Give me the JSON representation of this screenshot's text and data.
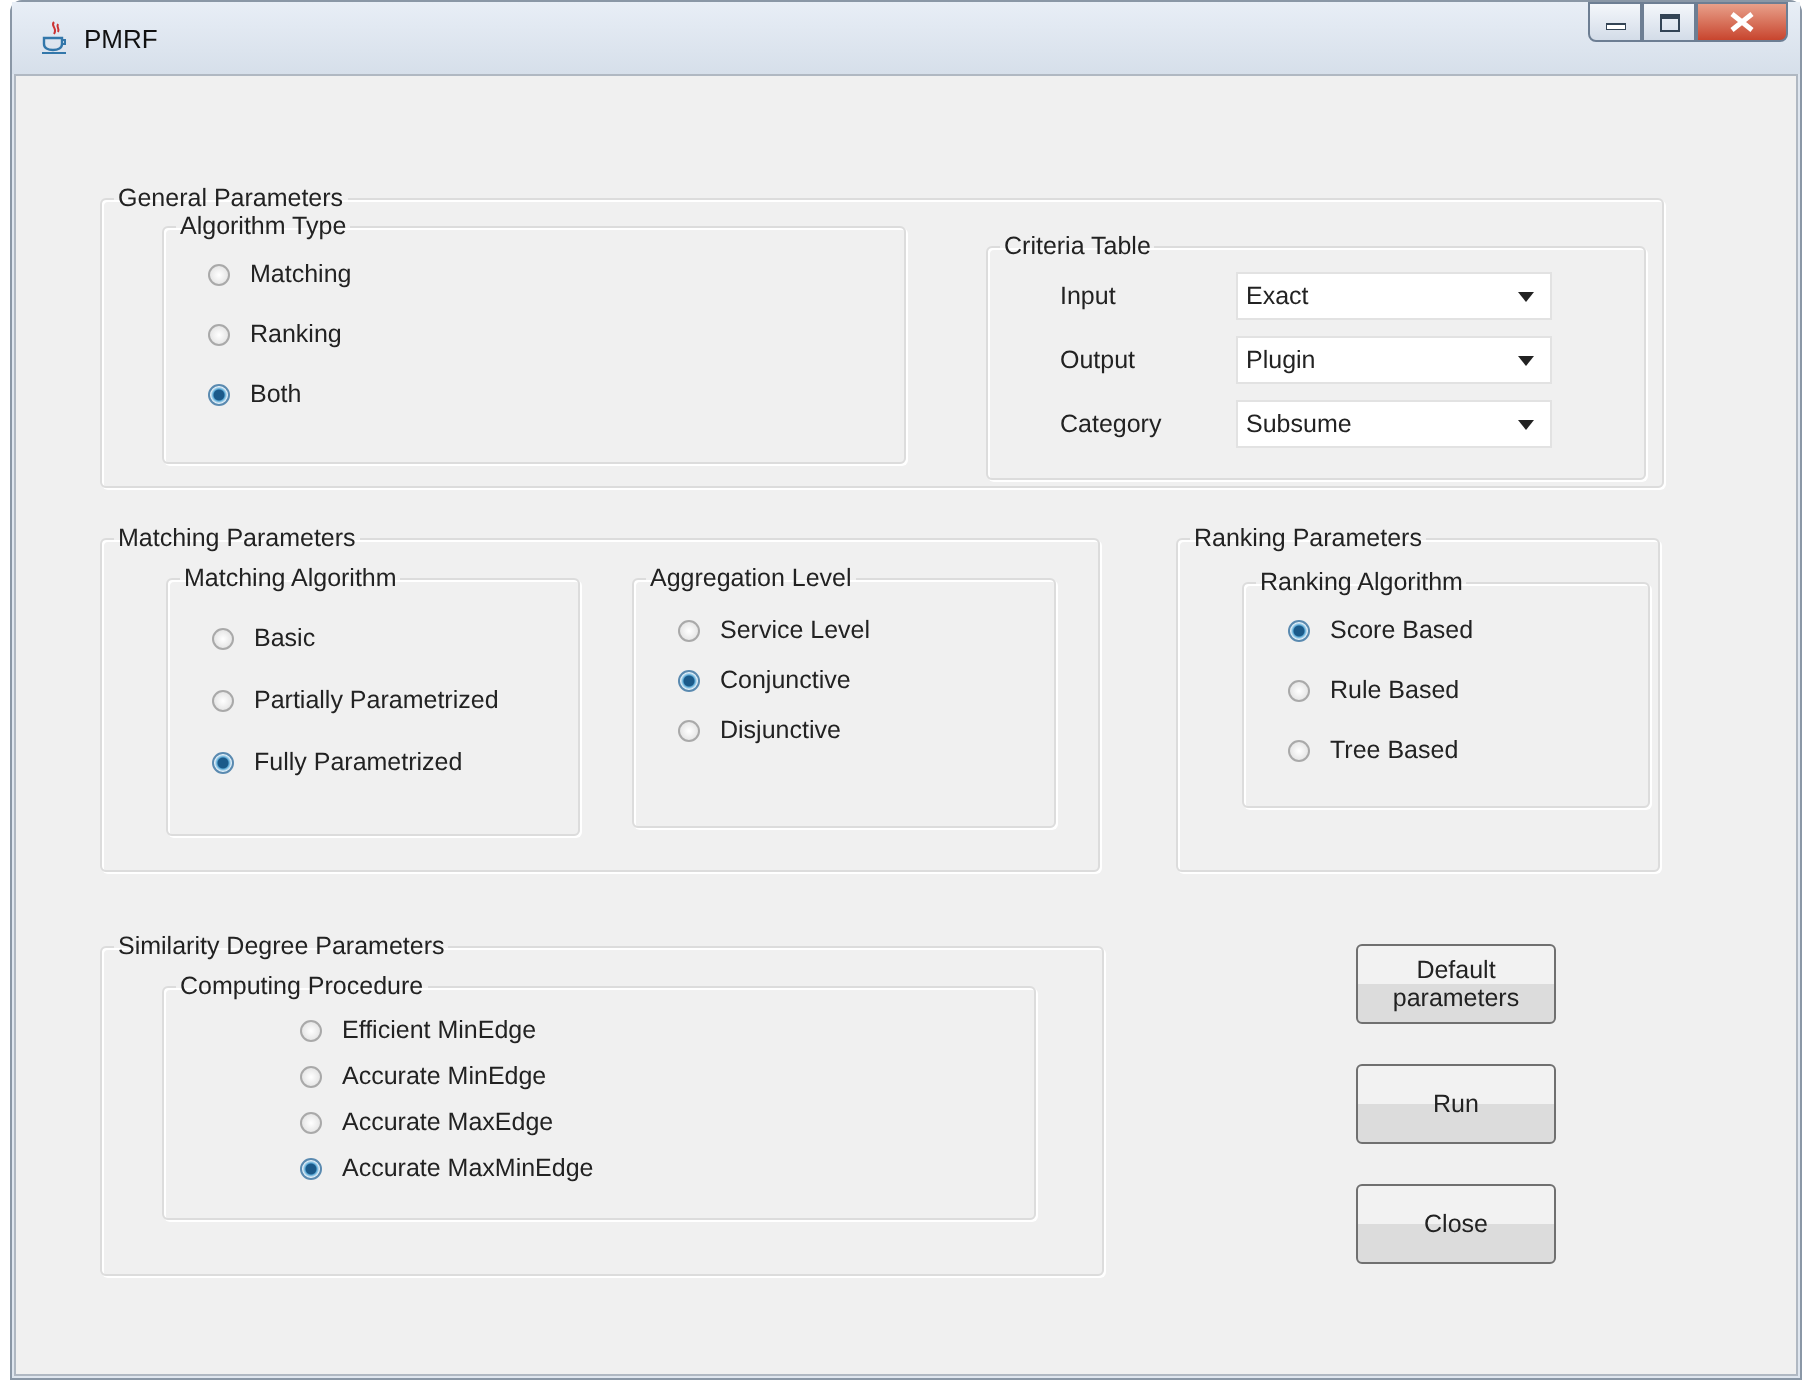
{
  "window": {
    "title": "PMRF"
  },
  "general_parameters": {
    "title": "General Parameters",
    "algorithm_type": {
      "title": "Algorithm Type",
      "options": [
        {
          "label": "Matching",
          "selected": false
        },
        {
          "label": "Ranking",
          "selected": false
        },
        {
          "label": "Both",
          "selected": true
        }
      ]
    },
    "criteria_table": {
      "title": "Criteria Table",
      "rows": [
        {
          "label": "Input",
          "value": "Exact"
        },
        {
          "label": "Output",
          "value": "Plugin"
        },
        {
          "label": "Category",
          "value": "Subsume"
        }
      ]
    }
  },
  "matching_parameters": {
    "title": "Matching Parameters",
    "matching_algorithm": {
      "title": "Matching Algorithm",
      "options": [
        {
          "label": "Basic",
          "selected": false
        },
        {
          "label": "Partially Parametrized",
          "selected": false
        },
        {
          "label": "Fully Parametrized",
          "selected": true
        }
      ]
    },
    "aggregation_level": {
      "title": "Aggregation Level",
      "options": [
        {
          "label": "Service Level",
          "selected": false
        },
        {
          "label": "Conjunctive",
          "selected": true
        },
        {
          "label": "Disjunctive",
          "selected": false
        }
      ]
    }
  },
  "ranking_parameters": {
    "title": "Ranking Parameters",
    "ranking_algorithm": {
      "title": "Ranking Algorithm",
      "options": [
        {
          "label": "Score Based",
          "selected": true
        },
        {
          "label": "Rule Based",
          "selected": false
        },
        {
          "label": "Tree Based",
          "selected": false
        }
      ]
    }
  },
  "similarity_degree_parameters": {
    "title": "Similarity Degree Parameters",
    "computing_procedure": {
      "title": "Computing Procedure",
      "options": [
        {
          "label": "Efficient MinEdge",
          "selected": false
        },
        {
          "label": "Accurate MinEdge",
          "selected": false
        },
        {
          "label": "Accurate MaxEdge",
          "selected": false
        },
        {
          "label": "Accurate MaxMinEdge",
          "selected": true
        }
      ]
    }
  },
  "buttons": [
    {
      "label": "Default parameters"
    },
    {
      "label": "Run"
    },
    {
      "label": "Close"
    }
  ]
}
